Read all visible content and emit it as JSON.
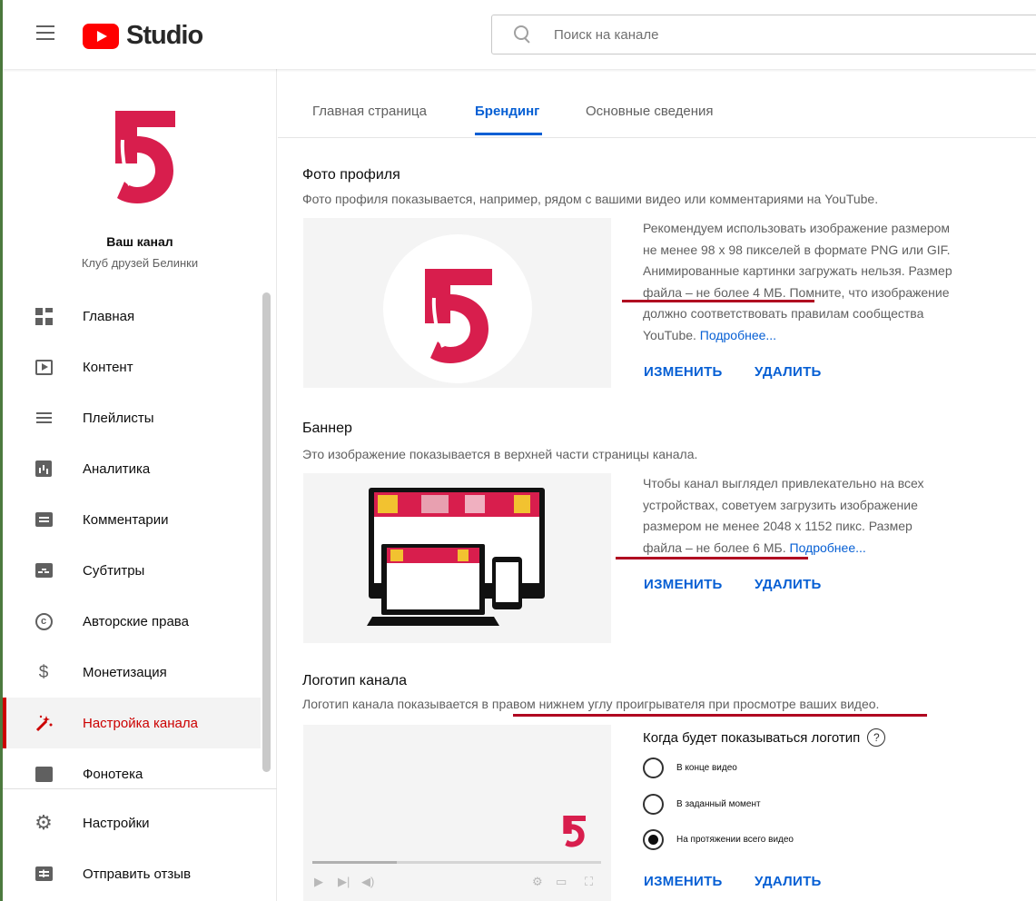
{
  "app": {
    "logo_text": "Studio",
    "search_placeholder": "Поиск на канале"
  },
  "sidebar": {
    "your_channel": "Ваш канал",
    "channel_name": "Клуб друзей Белинки",
    "items": [
      {
        "label": "Главная",
        "icon": "dashboard-icon"
      },
      {
        "label": "Контент",
        "icon": "content-icon"
      },
      {
        "label": "Плейлисты",
        "icon": "playlists-icon"
      },
      {
        "label": "Аналитика",
        "icon": "analytics-icon"
      },
      {
        "label": "Комментарии",
        "icon": "comments-icon"
      },
      {
        "label": "Субтитры",
        "icon": "subtitles-icon"
      },
      {
        "label": "Авторские права",
        "icon": "copyright-icon"
      },
      {
        "label": "Монетизация",
        "icon": "dollar-icon"
      },
      {
        "label": "Настройка канала",
        "icon": "magic-wand-icon",
        "active": true
      },
      {
        "label": "Фонотека",
        "icon": "audio-library-icon"
      }
    ],
    "bottom_items": [
      {
        "label": "Настройки",
        "icon": "gear-icon"
      },
      {
        "label": "Отправить отзыв",
        "icon": "feedback-icon"
      }
    ]
  },
  "tabs": [
    {
      "label": "Главная страница"
    },
    {
      "label": "Брендинг",
      "active": true
    },
    {
      "label": "Основные сведения"
    }
  ],
  "profile_photo": {
    "title": "Фото профиля",
    "desc": "Фото профиля показывается, например, рядом с вашими видео или комментариями на YouTube.",
    "info_lines": [
      "Рекомендуем использовать изображение размером",
      "не менее 98 х 98 пикселей в формате PNG или GIF.",
      "Анимированные картинки загружать нельзя. Размер",
      "файла – не более 4 МБ. Помните, что изображение",
      "должно соответствовать правилам сообщества"
    ],
    "info_last": "YouTube.",
    "more_link": "Подробнее...",
    "change": "ИЗМЕНИТЬ",
    "delete": "УДАЛИТЬ"
  },
  "banner": {
    "title": "Баннер",
    "desc": "Это изображение показывается в верхней части страницы канала.",
    "info_lines": [
      "Чтобы канал выглядел привлекательно на всех",
      "устройствах, советуем загрузить изображение",
      "размером не менее 2048 х 1152 пикс. Размер"
    ],
    "info_last": "файла – не более 6 МБ.",
    "more_link": "Подробнее...",
    "change": "ИЗМЕНИТЬ",
    "delete": "УДАЛИТЬ"
  },
  "logo": {
    "title": "Логотип канала",
    "desc": "Логотип канала показывается в правом нижнем углу проигрывателя при просмотре ваших видео.",
    "when_label": "Когда будет показываться логотип",
    "options": [
      {
        "label": "В конце видео",
        "checked": false
      },
      {
        "label": "В заданный момент",
        "checked": false
      },
      {
        "label": "На протяжении всего видео",
        "checked": true
      }
    ],
    "change": "ИЗМЕНИТЬ",
    "delete": "УДАЛИТЬ"
  },
  "colors": {
    "brand_red": "#d81e4d",
    "accent_blue": "#065fd4",
    "active_red": "#cc0000"
  }
}
